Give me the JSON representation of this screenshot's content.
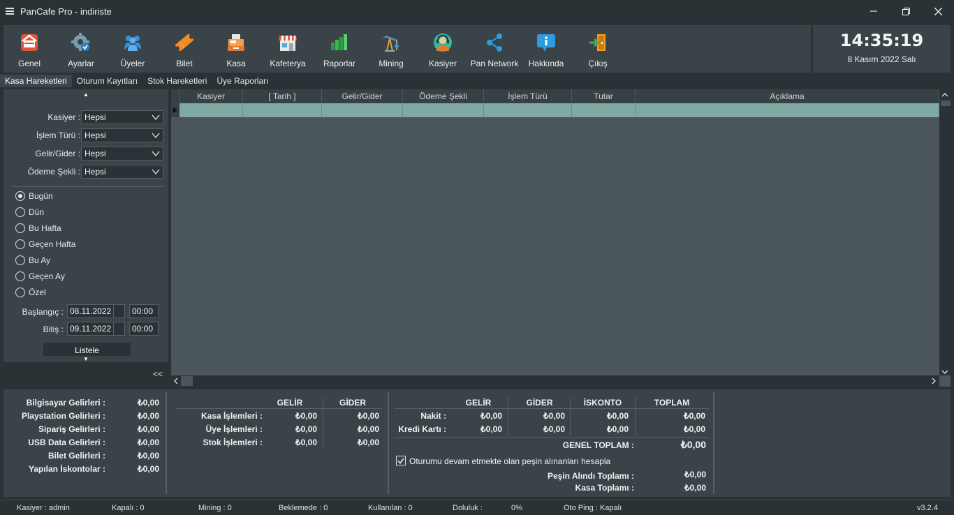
{
  "window": {
    "title": "PanCafe Pro - indiriste",
    "minimize_icon": "minimize-icon",
    "restore_icon": "restore-icon",
    "close_icon": "close-icon"
  },
  "toolbar": {
    "items": [
      {
        "label": "Genel",
        "icon": "home-icon",
        "color": "#e0543a"
      },
      {
        "label": "Ayarlar",
        "icon": "gear-icon",
        "color": "#7a9bb0"
      },
      {
        "label": "Üyeler",
        "icon": "users-icon",
        "color": "#3b8fd8"
      },
      {
        "label": "Bilet",
        "icon": "ticket-icon",
        "color": "#f08a24"
      },
      {
        "label": "Kasa",
        "icon": "cash-register-icon",
        "color": "#f2a14a"
      },
      {
        "label": "Kafeterya",
        "icon": "store-icon",
        "color": "#e85c3a"
      },
      {
        "label": "Raporlar",
        "icon": "bar-chart-icon",
        "color": "#3fb34f"
      },
      {
        "label": "Mining",
        "icon": "pump-jack-icon",
        "color": "#4a90c8"
      },
      {
        "label": "Kasiyer",
        "icon": "headset-user-icon",
        "color": "#35b6a0"
      },
      {
        "label": "Pan Network",
        "icon": "share-nodes-icon",
        "color": "#2f9be0"
      },
      {
        "label": "Hakkında",
        "icon": "info-bubble-icon",
        "color": "#2f9be0"
      },
      {
        "label": "Çıkış",
        "icon": "exit-door-icon",
        "color": "#f0a020"
      }
    ]
  },
  "clock": {
    "time": "14:35:19",
    "date": "8 Kasım 2022 Salı"
  },
  "tabs": [
    "Kasa Hareketleri",
    "Oturum Kayıtları",
    "Stok Hareketleri",
    "Üye Raporları"
  ],
  "filters": {
    "kasiyer": {
      "label": "Kasiyer :",
      "value": "Hepsi"
    },
    "islem_turu": {
      "label": "İşlem Türü :",
      "value": "Hepsi"
    },
    "gelir_gider": {
      "label": "Gelir/Gider :",
      "value": "Hepsi"
    },
    "odeme_sekli": {
      "label": "Ödeme Şekli :",
      "value": "Hepsi"
    },
    "periods": [
      "Bugün",
      "Dün",
      "Bu Hafta",
      "Geçen Hafta",
      "Bu Ay",
      "Geçen Ay",
      "Özel"
    ],
    "selected_period": "Bugün",
    "start": {
      "label": "Başlangıç :",
      "date": "08.11.2022",
      "time": "00:00"
    },
    "end": {
      "label": "Bitiş :",
      "date": "09.11.2022",
      "time": "00:00"
    },
    "list_button": "Listele",
    "collapse": "<<"
  },
  "grid": {
    "columns": [
      "Kasiyer",
      "[ Tarih ]",
      "Gelir/Gider",
      "Ödeme Şekli",
      "İşlem Türü",
      "Tutar",
      "Açıklama"
    ],
    "row_color": "#7fa9a1"
  },
  "income": {
    "rows": [
      {
        "label": "Bilgisayar Gelirleri :",
        "value": "₺0,00"
      },
      {
        "label": "Playstation Gelirleri :",
        "value": "₺0,00"
      },
      {
        "label": "Sipariş Gelirleri :",
        "value": "₺0,00"
      },
      {
        "label": "USB Data Gelirleri :",
        "value": "₺0,00"
      },
      {
        "label": "Bilet Gelirleri :",
        "value": "₺0,00"
      },
      {
        "label": "Yapılan İskontolar :",
        "value": "₺0,00"
      }
    ]
  },
  "operations": {
    "headers": [
      "GELİR",
      "GİDER"
    ],
    "rows": [
      {
        "label": "Kasa İşlemleri :",
        "gelir": "₺0,00",
        "gider": "₺0,00"
      },
      {
        "label": "Üye İşlemleri :",
        "gelir": "₺0,00",
        "gider": "₺0,00"
      },
      {
        "label": "Stok İşlemleri :",
        "gelir": "₺0,00",
        "gider": "₺0,00"
      }
    ]
  },
  "payments": {
    "headers": [
      "GELİR",
      "GİDER",
      "İSKONTO",
      "TOPLAM"
    ],
    "rows": [
      {
        "label": "Nakit :",
        "gelir": "₺0,00",
        "gider": "₺0,00",
        "iskonto": "₺0,00",
        "toplam": "₺0,00"
      },
      {
        "label": "Kredi Kartı :",
        "gelir": "₺0,00",
        "gider": "₺0,00",
        "iskonto": "₺0,00",
        "toplam": "₺0,00"
      }
    ],
    "genel_toplam_label": "GENEL TOPLAM :",
    "genel_toplam": "₺0,00",
    "checkbox_label": "Oturumu devam etmekte olan peşin alınanları hesapla",
    "checkbox_checked": true,
    "pesin_label": "Peşin Alındı Toplamı :",
    "pesin_value": "₺0,00",
    "kasa_label": "Kasa Toplamı :",
    "kasa_value": "₺0,00"
  },
  "status": {
    "kasiyer": "Kasiyer : admin",
    "kapali": "Kapalı : 0",
    "mining": "Mining : 0",
    "beklemede": "Beklemede : 0",
    "kullanilan": "Kullanılan : 0",
    "doluluk": "Doluluk :",
    "doluluk_value": "0%",
    "oto_ping": "Oto Ping : Kapalı",
    "version": "v3.2.4"
  }
}
